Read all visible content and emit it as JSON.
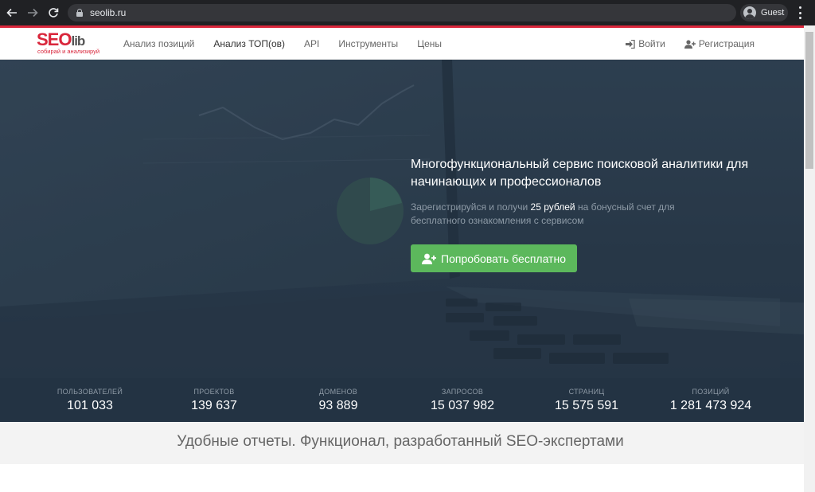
{
  "browser": {
    "url": "seolib.ru",
    "profile_label": "Guest"
  },
  "site": {
    "logo": {
      "brand_seo": "SEO",
      "brand_lib": "lib",
      "tagline": "собирай и анализируй"
    },
    "menu": [
      {
        "label": "Анализ позиций"
      },
      {
        "label": "Анализ ТОП(ов)"
      },
      {
        "label": "API"
      },
      {
        "label": "Инструменты"
      },
      {
        "label": "Цены"
      }
    ],
    "auth": {
      "login_label": "Войти",
      "register_label": "Регистрация"
    },
    "colors": {
      "brand_red": "#d9263b",
      "cta_green": "#5cb85c",
      "hero_bg": "#2c3d4e",
      "stats_bg": "#233343"
    }
  },
  "hero": {
    "title": "Многофункциональный сервис поисковой аналитики для начинающих и профессионалов",
    "subtitle_pre": "Зарегистрируйся и получи ",
    "subtitle_highlight": "25 рублей",
    "subtitle_post": " на бонусный счет для бесплатного ознакомления с сервисом",
    "cta_label": "Попробовать бесплатно"
  },
  "stats": [
    {
      "label": "ПОЛЬЗОВАТЕЛЕЙ",
      "value": "101 033"
    },
    {
      "label": "ПРОЕКТОВ",
      "value": "139 637"
    },
    {
      "label": "ДОМЕНОВ",
      "value": "93 889"
    },
    {
      "label": "ЗАПРОСОВ",
      "value": "15 037 982"
    },
    {
      "label": "СТРАНИЦ",
      "value": "15 575 591"
    },
    {
      "label": "ПОЗИЦИЙ",
      "value": "1 281 473 924"
    }
  ],
  "features": {
    "title": "Удобные отчеты. Функционал, разработанный SEO-экспертами"
  }
}
